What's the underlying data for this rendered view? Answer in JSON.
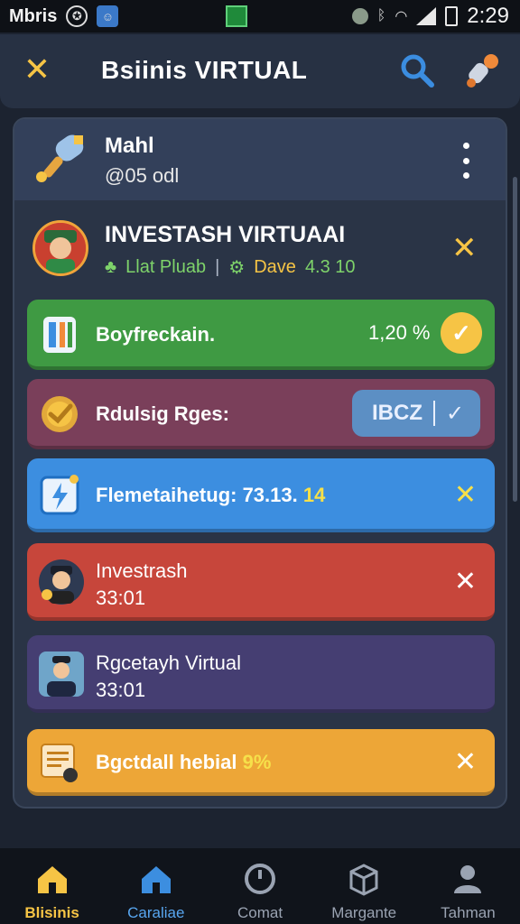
{
  "status_bar": {
    "carrier": "Mbris",
    "time": "2:29"
  },
  "app_bar": {
    "title": "Bsiinis VIRTUAL",
    "close_icon": "close-icon",
    "search_icon": "search-icon",
    "rocket_icon": "rocket-icon"
  },
  "account_card": {
    "name": "Mahl",
    "subtitle": "@05 odl"
  },
  "profile": {
    "title": "INVESTASH VIRTUAAI",
    "meta_left": "Llat Pluab",
    "meta_right_label": "Dave",
    "meta_right_value": "4.3 10"
  },
  "rows": [
    {
      "label": "Boyfreckain.",
      "value": "1,20 %"
    },
    {
      "label": "Rdulsig Rges:",
      "pill_text": "IBCZ"
    },
    {
      "label": "Flemetaihetug: 73.13.",
      "highlight": "14"
    },
    {
      "label": "Investrash",
      "sub": "33:01"
    },
    {
      "label": "Rgcetayh Virtual",
      "sub": "33:01"
    },
    {
      "label": "Bgctdall hebial",
      "highlight": "9%"
    }
  ],
  "bottom_nav": [
    {
      "label": "Blisinis",
      "icon": "home-icon"
    },
    {
      "label": "Caraliae",
      "icon": "house-icon"
    },
    {
      "label": "Comat",
      "icon": "clock-icon"
    },
    {
      "label": "Margante",
      "icon": "box-icon"
    },
    {
      "label": "Tahman",
      "icon": "user-icon"
    }
  ],
  "colors": {
    "accent": "#f6c445",
    "green_row": "#3f9a43",
    "purple_row": "#7a3f5a",
    "blue_row": "#3c8ee0",
    "red_row": "#c7463b",
    "indigo_row": "#453e72",
    "orange_row": "#eda637"
  }
}
